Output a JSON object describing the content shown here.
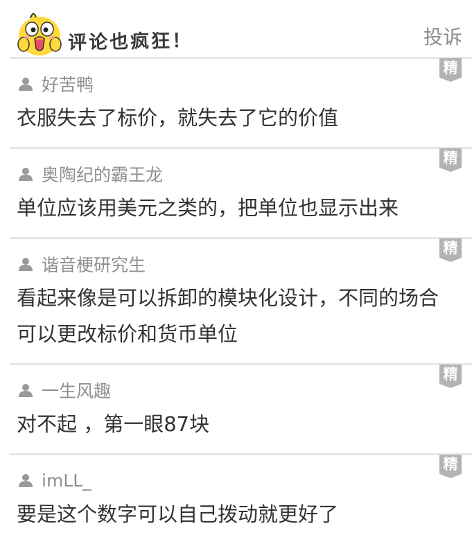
{
  "header": {
    "title": "评论也疯狂！",
    "report_label": "投诉",
    "mascot_icon": "yellow-chick-mascot-icon"
  },
  "colors": {
    "badge": "#b3b3b3",
    "divider": "#e6e6e6",
    "username": "#8f8f8f",
    "text": "#333333",
    "mascot": "#ffd93b"
  },
  "comments": [
    {
      "user": "好苦鸭",
      "text": "衣服失去了标价，就失去了它的价值",
      "badge": "精"
    },
    {
      "user": "奥陶纪的霸王龙",
      "text": "单位应该用美元之类的，把单位也显示出来",
      "badge": "精"
    },
    {
      "user": "谐音梗研究生",
      "text": "看起来像是可以拆卸的模块化设计，不同的场合可以更改标价和货币单位",
      "badge": "精"
    },
    {
      "user": "一生风趣",
      "text": "对不起 ，第一眼87块",
      "badge": "精"
    },
    {
      "user": "imLL_",
      "text": "要是这个数字可以自己拨动就更好了",
      "badge": "精"
    }
  ]
}
